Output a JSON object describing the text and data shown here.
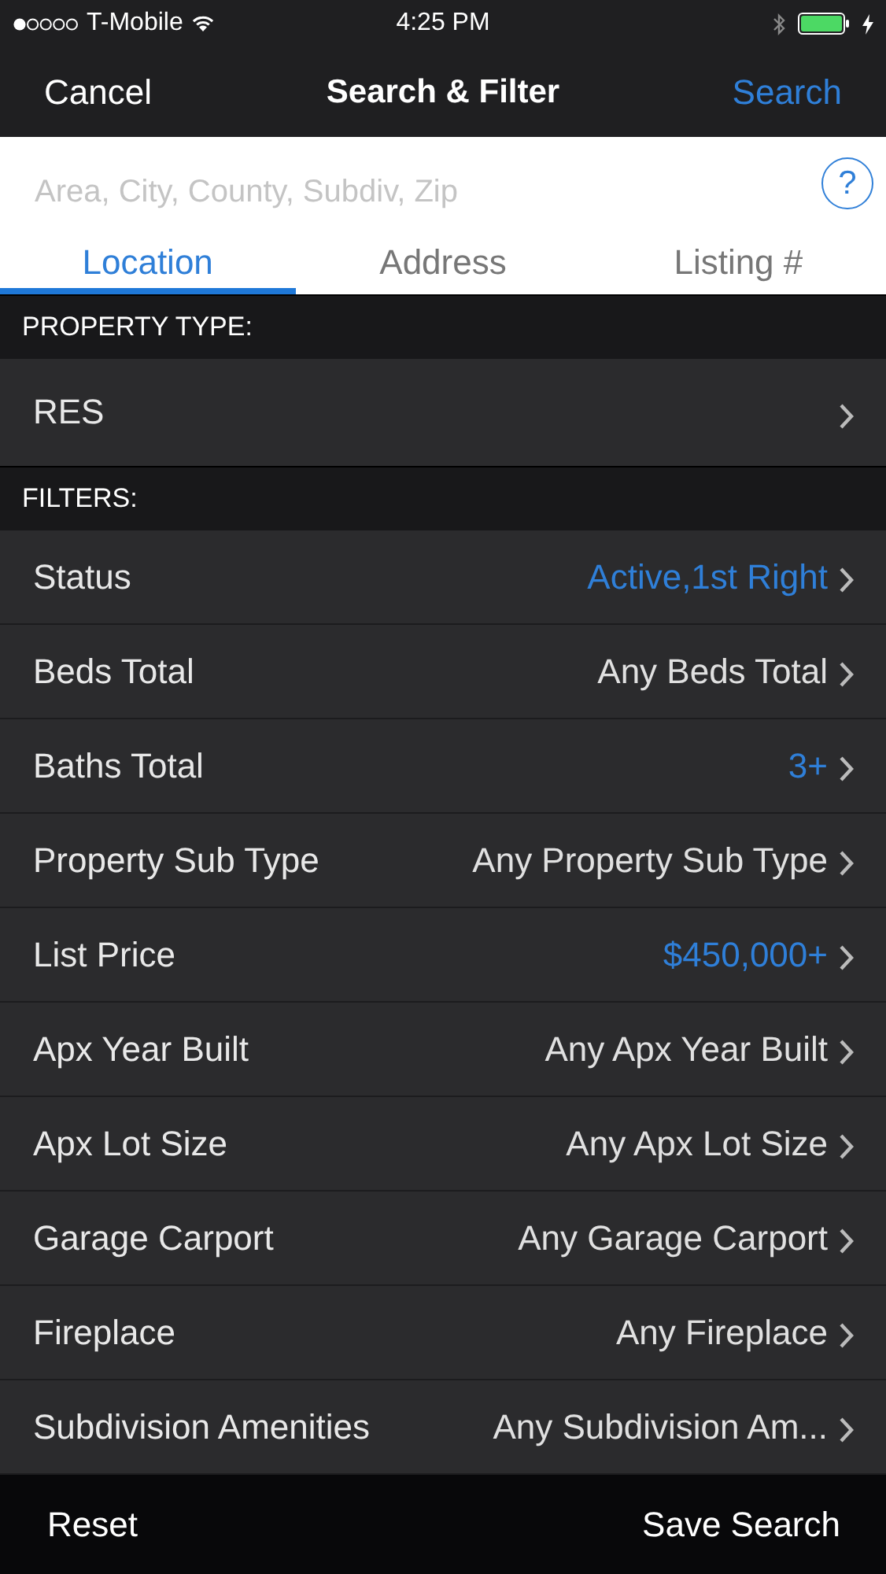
{
  "status_bar": {
    "carrier": "T-Mobile",
    "time": "4:25 PM"
  },
  "nav": {
    "cancel": "Cancel",
    "title": "Search & Filter",
    "search": "Search"
  },
  "search": {
    "placeholder": "Area, City, County, Subdiv, Zip",
    "help": "?"
  },
  "tabs": [
    {
      "label": "Location",
      "selected": true
    },
    {
      "label": "Address",
      "selected": false
    },
    {
      "label": "Listing #",
      "selected": false
    }
  ],
  "property_type": {
    "header": "PROPERTY TYPE:",
    "value": "RES"
  },
  "filters": {
    "header": "FILTERS:",
    "rows": [
      {
        "label": "Status",
        "value": "Active,1st Right",
        "active": true
      },
      {
        "label": "Beds Total",
        "value": "Any Beds Total",
        "active": false
      },
      {
        "label": "Baths Total",
        "value": "3+",
        "active": true
      },
      {
        "label": "Property Sub Type",
        "value": "Any Property Sub Type",
        "active": false
      },
      {
        "label": "List Price",
        "value": "$450,000+",
        "active": true
      },
      {
        "label": "Apx Year Built",
        "value": "Any Apx Year Built",
        "active": false
      },
      {
        "label": "Apx Lot Size",
        "value": "Any Apx Lot Size",
        "active": false
      },
      {
        "label": "Garage Carport",
        "value": "Any Garage Carport",
        "active": false
      },
      {
        "label": "Fireplace",
        "value": "Any Fireplace",
        "active": false
      },
      {
        "label": "Subdivision Amenities",
        "value": "Any Subdivision Am...",
        "active": false
      }
    ]
  },
  "toolbar": {
    "reset": "Reset",
    "save": "Save Search"
  }
}
